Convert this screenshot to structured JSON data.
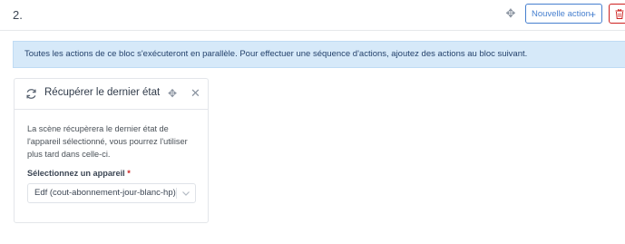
{
  "block": {
    "number": "2.",
    "new_action_label": "Nouvelle action",
    "new_action_icon": "+",
    "accent_color": "#467fcf",
    "danger_color": "#cd201f"
  },
  "alert": {
    "text": "Toutes les actions de ce bloc s'exécuteront en parallèle. Pour effectuer une séquence d'actions, ajoutez des actions au bloc suivant."
  },
  "action_card": {
    "title": "Récupérer le dernier état",
    "description": "La scène récupèrera le dernier état de l'appareil sélectionné, vous pourrez l'utiliser plus tard dans celle-ci.",
    "field_label": "Sélectionnez un appareil",
    "required_mark": "*",
    "selected_device": "Edf (cout-abonnement-jour-blanc-hp)"
  }
}
